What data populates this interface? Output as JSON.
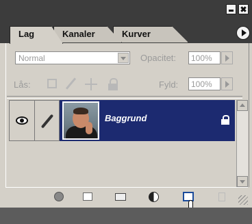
{
  "panel": {
    "tabs": [
      {
        "label": "Lag",
        "active": true
      },
      {
        "label": "Kanaler",
        "active": false
      },
      {
        "label": "Kurver",
        "active": false
      }
    ],
    "blend_mode": "Normal",
    "opacity_label": "Opacitet:",
    "opacity_value": "100%",
    "lock_label": "Lås:",
    "fill_label": "Fyld:",
    "fill_value": "100%",
    "layers": [
      {
        "name": "Baggrund",
        "visible": true,
        "locked": true,
        "selected": true
      }
    ],
    "bottom_icons": [
      "layer-style-icon",
      "add-mask-icon",
      "new-group-icon",
      "adjustment-layer-icon",
      "new-layer-icon",
      "delete-layer-icon"
    ],
    "colors": {
      "panel_bg": "#d4d0c8",
      "selection": "#1c2a70",
      "title_bar": "#3c3c3c"
    }
  }
}
